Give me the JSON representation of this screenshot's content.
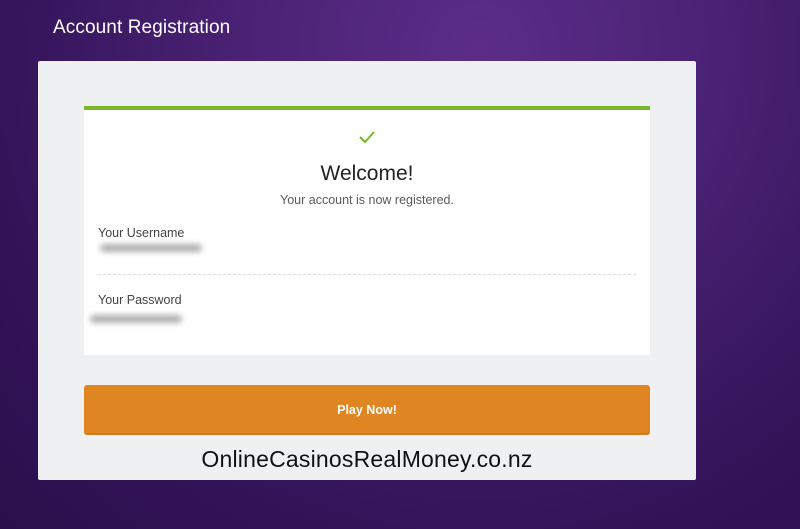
{
  "header": {
    "title": "Account Registration"
  },
  "card": {
    "icon": "checkmark-icon",
    "title": "Welcome!",
    "subtitle": "Your account is now registered.",
    "username_label": "Your Username",
    "password_label": "Your Password"
  },
  "actions": {
    "play_label": "Play Now!"
  },
  "watermark": {
    "text": "OnlineCasinosRealMoney.co.nz"
  },
  "colors": {
    "accent_green": "#79b72a",
    "button_orange": "#df8622",
    "background_purple": "#4a2274"
  }
}
